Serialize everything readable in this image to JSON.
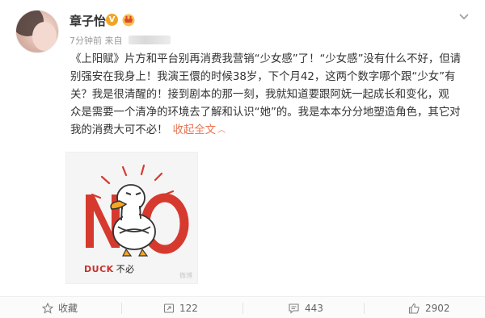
{
  "post": {
    "author": "章子怡",
    "verified_badge": "V",
    "time": "7分钟前",
    "source_prefix": "来自",
    "paragraph_lines": [
      "《上阳赋》片方和平台别再消费我营销“少女感”了！“少女感”没有什么不好，但请",
      "别强安在我身上！我演王儇的时候38岁，下个月42，这两个数字哪个跟“少女”有",
      "关？我是很清醒的！接到剧本的那一刻，我就知道要跟阿妩一起成长和变化，观",
      "众是需要一个清净的环境去了解和认识“她”的。我是本本分分地塑造角色，其它对"
    ],
    "last_line": "我的消费大可不必！",
    "collapse_label": "收起全文",
    "image": {
      "big_text": "NO",
      "caption_en": "DUCK",
      "caption_cn": "不必",
      "watermark": "微博"
    }
  },
  "actions": {
    "favorite_label": "收藏",
    "repost_count": "122",
    "comment_count": "443",
    "like_count": "2902"
  },
  "colors": {
    "accent": "#eb7350",
    "badge": "#f0a526",
    "no_red": "#d63a2f"
  }
}
